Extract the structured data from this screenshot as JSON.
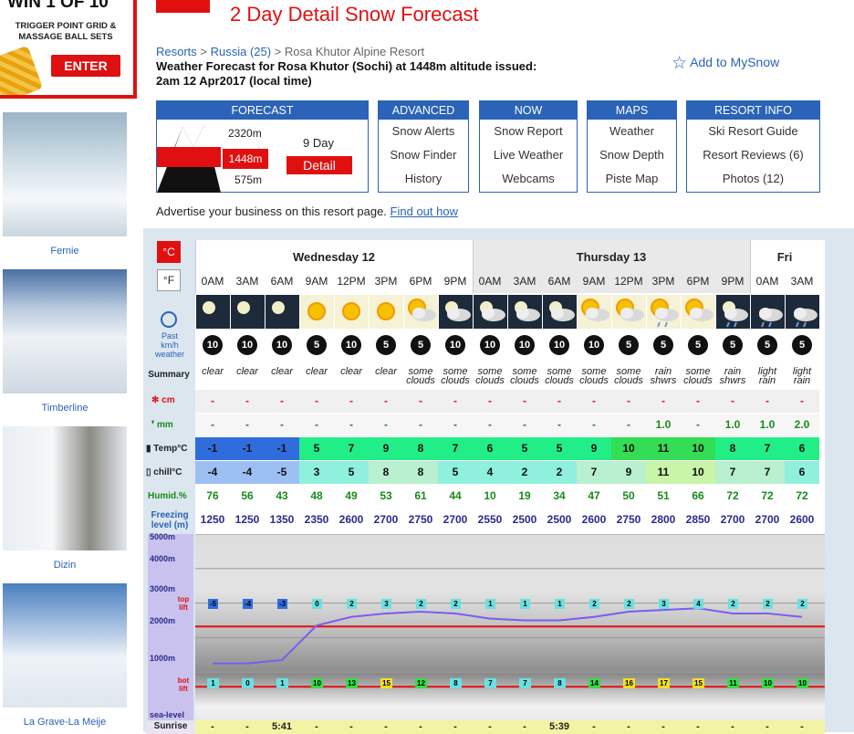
{
  "ad": {
    "line1": "WIN 1 OF 10",
    "line2": "TRIGGER POINT GRID & MASSAGE BALL SETS",
    "cta": "ENTER"
  },
  "sidebar": [
    {
      "label": "Fernie"
    },
    {
      "label": "Timberline"
    },
    {
      "label": "Dizin"
    },
    {
      "label": "La Grave-La Meije"
    }
  ],
  "header": {
    "title": "2 Day Detail Snow Forecast",
    "crumbs": [
      "Resorts",
      "Russia (25)",
      "Rosa Khutor Alpine Resort"
    ],
    "issued": "Weather Forecast for Rosa Khutor (Sochi) at 1448m altitude issued: 2am 12 Apr2017 (local time)",
    "mysnow": "Add to MySnow"
  },
  "nav": [
    {
      "head": "FORECAST",
      "elev": [
        "2320m",
        "1448m",
        "575m"
      ],
      "nine_day": "9 Day",
      "detail": "Detail"
    },
    {
      "head": "ADVANCED",
      "items": [
        "Snow Alerts",
        "Snow Finder",
        "History"
      ]
    },
    {
      "head": "NOW",
      "items": [
        "Snow Report",
        "Live Weather",
        "Webcams"
      ]
    },
    {
      "head": "MAPS",
      "items": [
        "Weather",
        "Snow Depth",
        "Piste Map"
      ]
    },
    {
      "head": "RESORT INFO",
      "items": [
        "Ski Resort Guide",
        "Resort Reviews (6)",
        "Photos (12)"
      ]
    }
  ],
  "advert": {
    "text": "Advertise your business on this resort page.",
    "link": "Find out how"
  },
  "units": {
    "c": "°C",
    "f": "°F"
  },
  "labels": {
    "past": "Past",
    "kmh": "km/h",
    "weather": "weather",
    "summary": "Summary",
    "cm": "cm",
    "mm": "mm",
    "temp": "Temp°C",
    "chill": "chill°C",
    "humid": "Humid.%",
    "freezing": "Freezing level (m)",
    "alt": [
      "5000m",
      "4000m",
      "3000m",
      "2000m",
      "1000m",
      "sea-level"
    ],
    "top": "top lift",
    "bot": "bot lift",
    "sunrise": "Sunrise"
  },
  "days": [
    "Wednesday 12",
    "Thursday 13",
    "Fri"
  ],
  "times": [
    "0AM",
    "3AM",
    "6AM",
    "9AM",
    "12PM",
    "3PM",
    "6PM",
    "9PM",
    "0AM",
    "3AM",
    "6AM",
    "9AM",
    "12PM",
    "3PM",
    "6PM",
    "9PM",
    "0AM",
    "3AM"
  ],
  "icons": [
    "moon",
    "moon",
    "moon",
    "sun",
    "sun",
    "sun",
    "suncloud",
    "mooncloud",
    "mooncloud",
    "mooncloud",
    "mooncloud",
    "suncloud",
    "suncloud",
    "sunrain",
    "suncloud",
    "mooncloudrain",
    "rain",
    "rain"
  ],
  "wind": [
    "10",
    "10",
    "10",
    "5",
    "10",
    "5",
    "5",
    "10",
    "10",
    "10",
    "10",
    "10",
    "5",
    "5",
    "5",
    "5",
    "5",
    "5"
  ],
  "summary": [
    "clear",
    "clear",
    "clear",
    "clear",
    "clear",
    "clear",
    "some clouds",
    "some clouds",
    "some clouds",
    "some clouds",
    "some clouds",
    "some clouds",
    "some clouds",
    "rain shwrs",
    "some clouds",
    "rain shwrs",
    "light rain",
    "light rain"
  ],
  "snow": [
    "-",
    "-",
    "-",
    "-",
    "-",
    "-",
    "-",
    "-",
    "-",
    "-",
    "-",
    "-",
    "-",
    "-",
    "-",
    "-",
    "-",
    "-"
  ],
  "rain": [
    "-",
    "-",
    "-",
    "-",
    "-",
    "-",
    "-",
    "-",
    "-",
    "-",
    "-",
    "-",
    "-",
    "1.0",
    "-",
    "1.0",
    "1.0",
    "2.0"
  ],
  "temp": [
    "-1",
    "-1",
    "-1",
    "5",
    "7",
    "9",
    "8",
    "7",
    "6",
    "5",
    "5",
    "9",
    "10",
    "11",
    "10",
    "8",
    "7",
    "6"
  ],
  "chill": [
    "-4",
    "-4",
    "-5",
    "3",
    "5",
    "8",
    "8",
    "5",
    "4",
    "2",
    "2",
    "7",
    "9",
    "11",
    "10",
    "7",
    "7",
    "6"
  ],
  "humid": [
    "76",
    "56",
    "43",
    "48",
    "49",
    "53",
    "61",
    "44",
    "10",
    "19",
    "34",
    "47",
    "50",
    "51",
    "66",
    "72",
    "72",
    "72"
  ],
  "freezing": [
    "1250",
    "1250",
    "1350",
    "2350",
    "2600",
    "2700",
    "2750",
    "2700",
    "2550",
    "2500",
    "2500",
    "2600",
    "2750",
    "2800",
    "2850",
    "2700",
    "2700",
    "2600"
  ],
  "top_lift_temps": [
    "-5",
    "-4",
    "-3",
    "0",
    "2",
    "3",
    "2",
    "2",
    "1",
    "1",
    "1",
    "2",
    "2",
    "3",
    "4",
    "2",
    "2",
    "2"
  ],
  "bot_lift_temps": [
    "1",
    "0",
    "1",
    "10",
    "13",
    "15",
    "12",
    "8",
    "7",
    "7",
    "8",
    "14",
    "16",
    "17",
    "15",
    "11",
    "10",
    "10"
  ],
  "sunrise": [
    "-",
    "-",
    "5:41",
    "-",
    "-",
    "-",
    "-",
    "-",
    "-",
    "-",
    "5:39",
    "-",
    "-",
    "-",
    "-",
    "-",
    "-",
    "-"
  ],
  "colors": {
    "accent": "#2a63b7",
    "red": "#e01010"
  }
}
